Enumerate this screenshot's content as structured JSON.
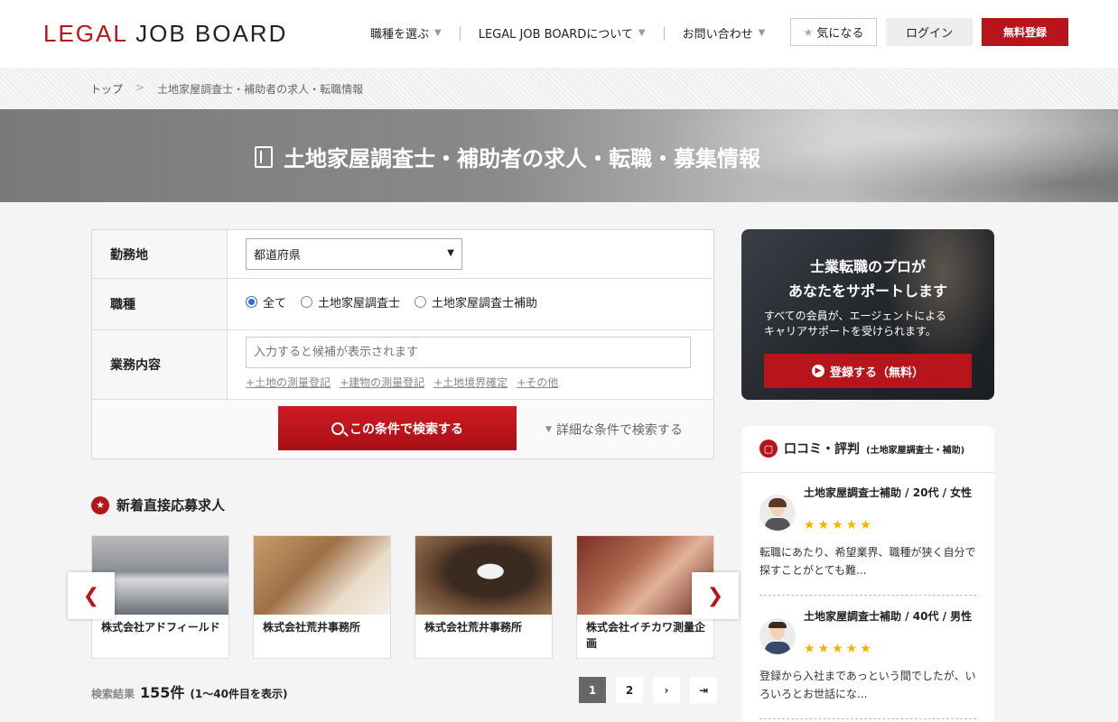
{
  "header": {
    "logo_part1": "LEGAL",
    "logo_part2": "JOB BOARD",
    "nav": [
      "職種を選ぶ",
      "LEGAL JOB BOARDについて",
      "お問い合わせ"
    ],
    "fav_label": "気になる",
    "login_label": "ログイン",
    "register_label": "無料登録"
  },
  "breadcrumb": {
    "home": "トップ",
    "separator": ">",
    "current": "土地家屋調査士・補助者の求人・転職情報"
  },
  "hero": {
    "title": "土地家屋調査士・補助者の求人・転職・募集情報"
  },
  "search_form": {
    "location_label": "勤務地",
    "location_select": "都道府県",
    "job_type_label": "職種",
    "job_types": [
      "全て",
      "土地家屋調査士",
      "土地家屋調査士補助"
    ],
    "job_type_selected": "全て",
    "duties_label": "業務内容",
    "duties_placeholder": "入力すると候補が表示されます",
    "duty_tags": [
      "+土地の測量登記",
      "+建物の測量登記",
      "+土地境界確定",
      "+その他"
    ],
    "search_button": "この条件で検索する",
    "advanced_link": "詳細な条件で検索する"
  },
  "new_jobs": {
    "title": "新着直接応募求人",
    "cards": [
      {
        "company": "株式会社アドフィールド"
      },
      {
        "company": "株式会社荒井事務所"
      },
      {
        "company": "株式会社荒井事務所"
      },
      {
        "company": "株式会社イチカワ測量企画"
      }
    ],
    "prev_label": "❮",
    "next_label": "❯"
  },
  "results": {
    "label": "検索結果",
    "count": "155件",
    "range": "(1〜40件目を表示)"
  },
  "pagination": {
    "pages": [
      "1",
      "2"
    ],
    "current": "1",
    "next_label": "›",
    "last_label": "⇥"
  },
  "promo": {
    "heading_line1": "士業転職のプロが",
    "heading_line2": "あなたをサポートします",
    "text_line1": "すべての会員が、エージェントによる",
    "text_line2": "キャリアサポートを受けられます。",
    "button": "登録する（無料）"
  },
  "reviews": {
    "title": "口コミ・評判",
    "subtitle": "(土地家屋調査士・補助)",
    "items": [
      {
        "meta": "土地家屋調査士補助 / 20代 / 女性",
        "stars": "★★★★★",
        "text": "転職にあたり、希望業界、職種が狭く自分で探すことがとても難..."
      },
      {
        "meta": "土地家屋調査士補助 / 40代 / 男性",
        "stars": "★★★★★",
        "text": "登録から入社まであっという間でしたが、いろいろとお世話にな..."
      }
    ]
  },
  "colors": {
    "brand_red": "#b8141b",
    "radio_blue": "#2c6ed6",
    "star_gold": "#f0b400"
  }
}
